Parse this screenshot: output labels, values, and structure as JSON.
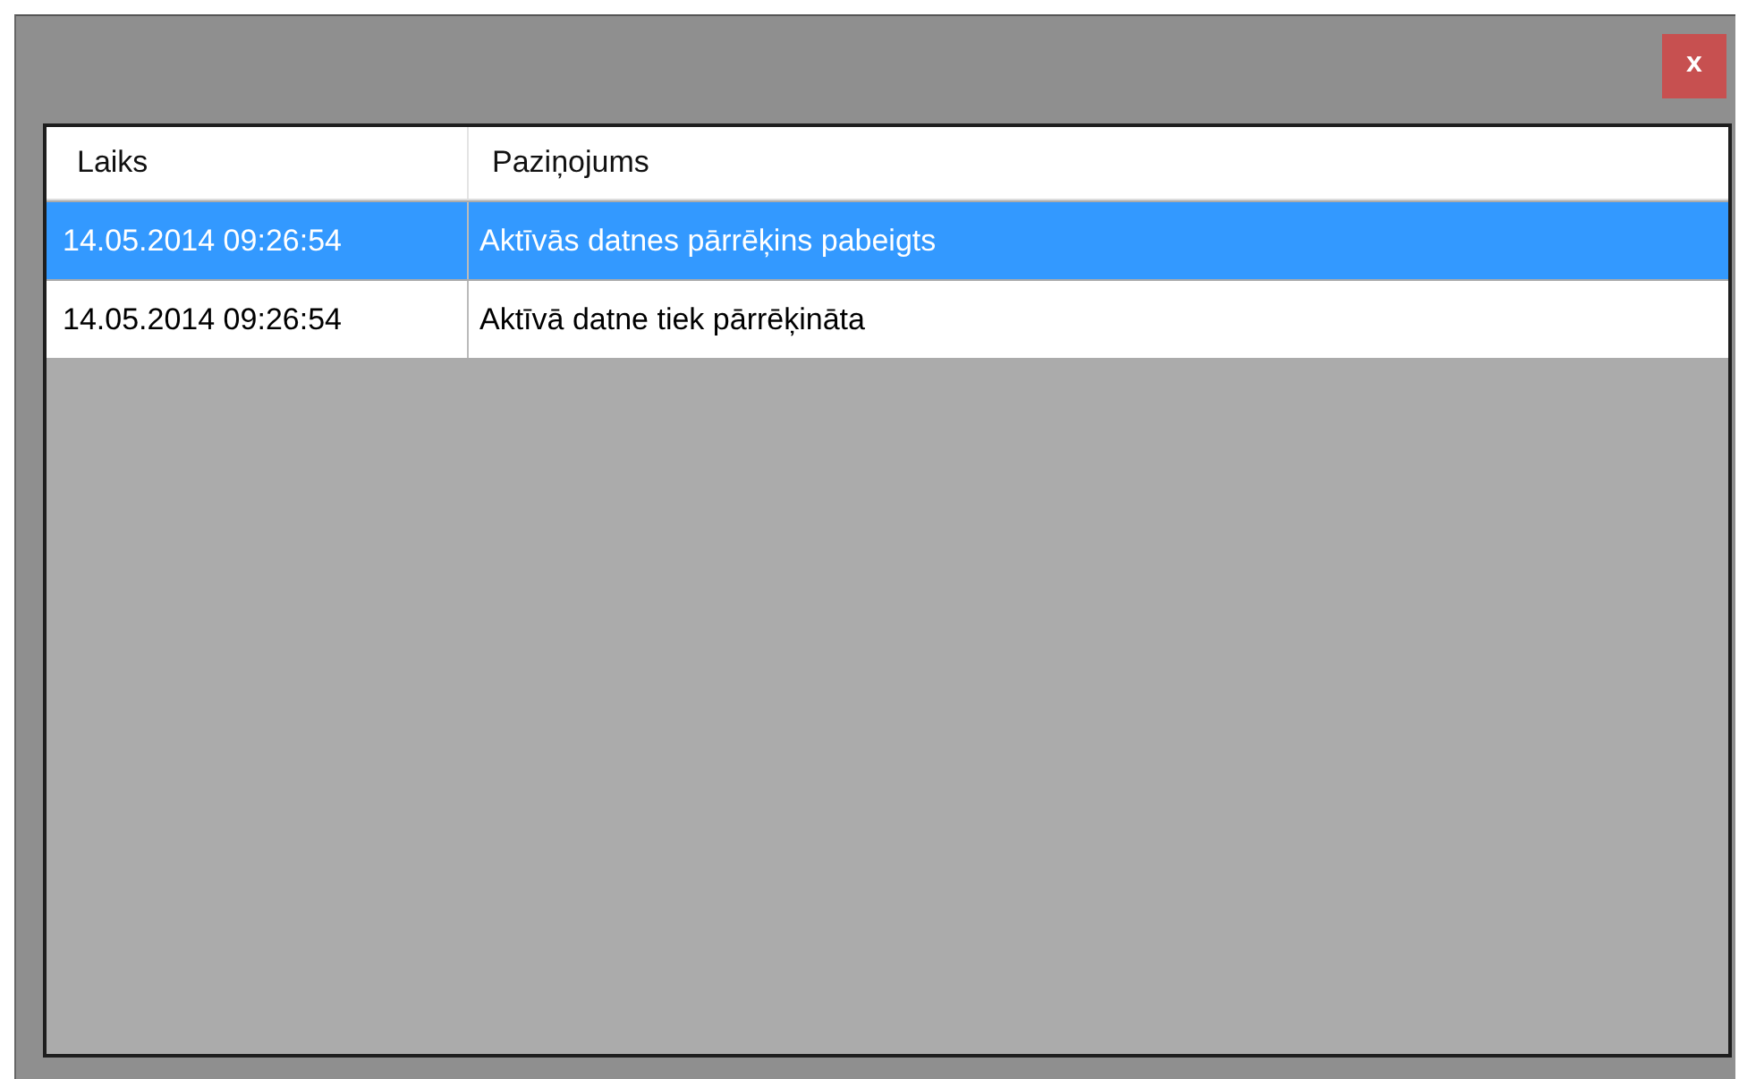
{
  "window": {
    "close_label": "x"
  },
  "table": {
    "columns": [
      "Laiks",
      "Paziņojums"
    ],
    "rows": [
      {
        "cells": [
          "14.05.2014 09:26:54",
          "Aktīvās datnes pārrēķins pabeigts"
        ],
        "selected": true
      },
      {
        "cells": [
          "14.05.2014 09:26:54",
          "Aktīvā datne tiek pārrēķināta"
        ],
        "selected": false
      }
    ]
  }
}
